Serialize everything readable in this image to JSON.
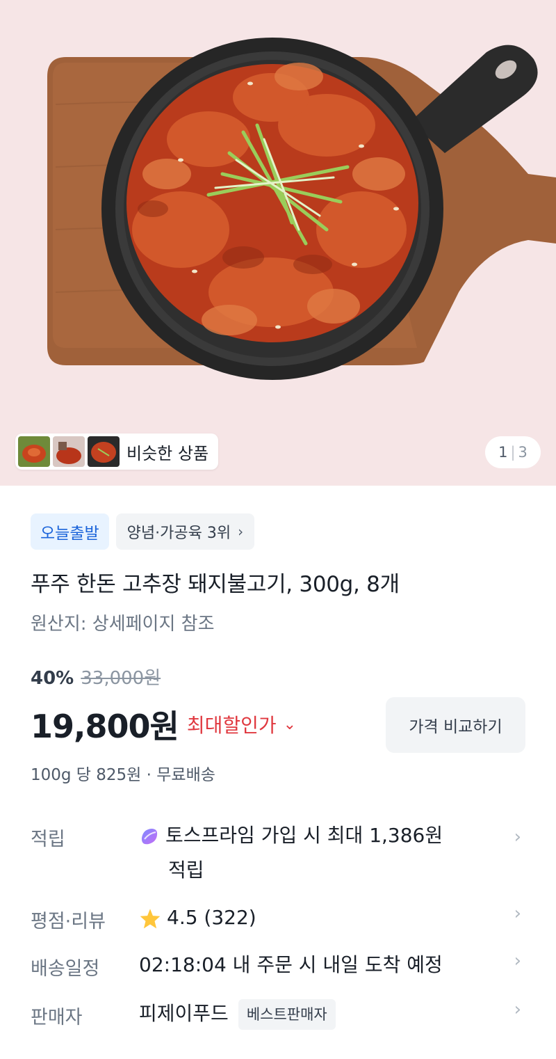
{
  "gallery": {
    "similar_label": "비슷한 상품",
    "counter_current": "1",
    "counter_separator": "|",
    "counter_total": "3"
  },
  "badges": {
    "delivery": "오늘출발",
    "ranking": "양념·가공육 3위"
  },
  "product": {
    "title": "푸주 한돈 고추장 돼지불고기, 300g, 8개",
    "origin": "원산지: 상세페이지 참조"
  },
  "price": {
    "discount_rate": "40%",
    "original": "33,000원",
    "current": "19,800원",
    "max_discount_label": "최대할인가",
    "compare_button": "가격 비교하기",
    "unit_price": "100g 당 825원 · 무료배송"
  },
  "details": {
    "points_label": "적립",
    "points_line1": "토스프라임 가입 시 최대 1,386원",
    "points_line2": "적립",
    "rating_label": "평점·리뷰",
    "rating_value": "4.5 (322)",
    "shipping_label": "배송일정",
    "shipping_value": "02:18:04 내 주문 시 내일 도착 예정",
    "seller_label": "판매자",
    "seller_value": "피제이푸드",
    "seller_badge": "베스트판매자"
  },
  "icons": {
    "chevron": "chevron-right-icon",
    "rating": "star-icon",
    "points": "toss-prime-icon"
  },
  "colors": {
    "accent_blue": "#1b64da",
    "discount_red": "#e0383f",
    "star": "#ffc63b",
    "hero_background": "#f6e5e6"
  }
}
